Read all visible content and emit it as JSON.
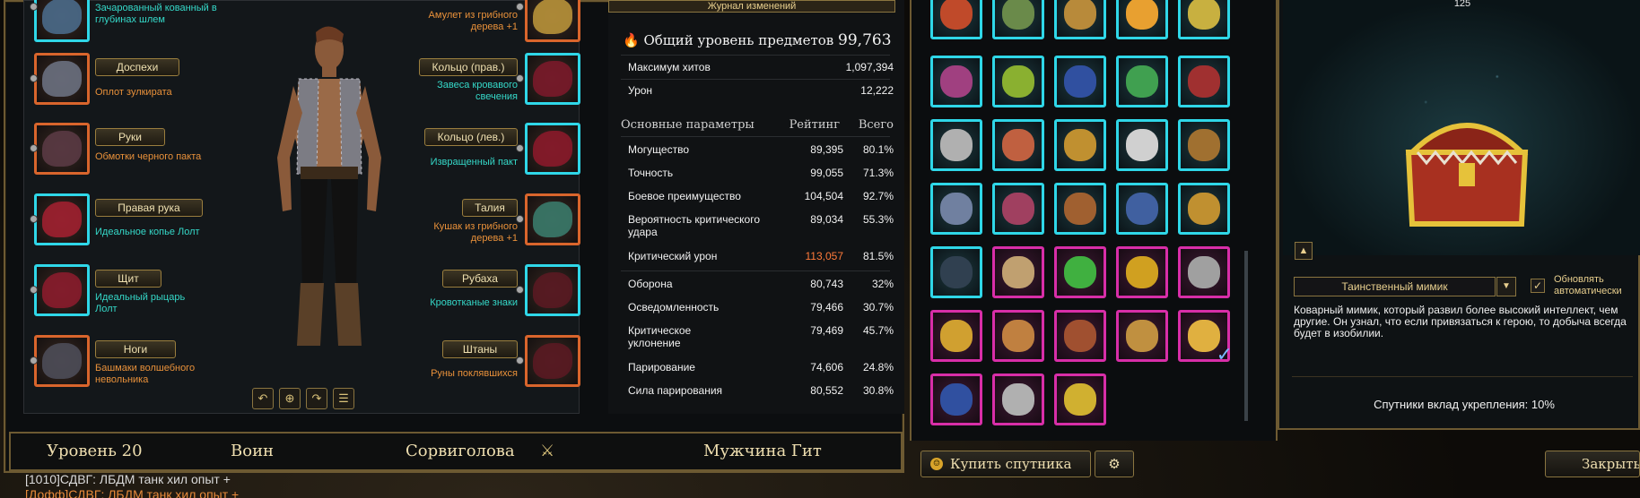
{
  "left_slots": [
    {
      "label": "",
      "name": "Зачарованный кованный в глубинах шлем",
      "color": "cyt"
    },
    {
      "label": "Доспехи",
      "name": "Оплот зулкирата",
      "color": "orf"
    },
    {
      "label": "Руки",
      "name": "Обмотки черного пакта",
      "color": "orf"
    },
    {
      "label": "Правая рука",
      "name": "Идеальное копье Лолт",
      "color": "cyt"
    },
    {
      "label": "Щит",
      "name": "Идеальный рыцарь Лолт",
      "color": "cyt"
    },
    {
      "label": "Ноги",
      "name": "Башмаки волшебного невольника",
      "color": "orf"
    }
  ],
  "right_slots": [
    {
      "label": "",
      "name": "Амулет из грибного дерева +1",
      "color": "orf"
    },
    {
      "label": "Кольцо (прав.)",
      "name": "Завеса кровавого свечения",
      "color": "cyt"
    },
    {
      "label": "Кольцо (лев.)",
      "name": "Извращенный пакт",
      "color": "cyt"
    },
    {
      "label": "Талия",
      "name": "Кушак из грибного дерева +1",
      "color": "orf"
    },
    {
      "label": "Рубаха",
      "name": "Кровотканые знаки",
      "color": "cyt"
    },
    {
      "label": "Штаны",
      "name": "Руны поклявшихся",
      "color": "orf"
    }
  ],
  "stats": {
    "journal": "Журнал изменений",
    "item_level_label": "Общий уровень предметов",
    "item_level": "99,763",
    "max_hp_label": "Максимум хитов",
    "max_hp": "1,097,394",
    "damage_label": "Урон",
    "damage": "12,222",
    "headers": {
      "main": "Основные параметры",
      "rating": "Рейтинг",
      "total": "Всего"
    },
    "rows": [
      {
        "name": "Могущество",
        "rating": "89,395",
        "pct": "80.1%"
      },
      {
        "name": "Точность",
        "rating": "99,055",
        "pct": "71.3%"
      },
      {
        "name": "Боевое преимущество",
        "rating": "104,504",
        "pct": "92.7%"
      },
      {
        "name": "Вероятность критического удара",
        "rating": "89,034",
        "pct": "55.3%"
      },
      {
        "name": "Критический урон",
        "rating": "113,057",
        "pct": "81.5%"
      },
      {
        "name": "Оборона",
        "rating": "80,743",
        "pct": "32%"
      },
      {
        "name": "Осведомленность",
        "rating": "79,466",
        "pct": "30.7%"
      },
      {
        "name": "Критическое уклонение",
        "rating": "79,469",
        "pct": "45.7%"
      },
      {
        "name": "Парирование",
        "rating": "74,606",
        "pct": "24.8%"
      },
      {
        "name": "Сила парирования",
        "rating": "80,552",
        "pct": "30.8%"
      }
    ]
  },
  "bottom": {
    "level": "Уровень 20",
    "class": "Воин",
    "paragon": "Сорвиголова",
    "race": "Мужчина Гит"
  },
  "chat": [
    "[1010]СДВГ: ЛБДМ танк хил опыт +",
    "[Дофф]СДВГ: ЛБДМ танк хил опыт +"
  ],
  "companion": {
    "top_number": "125",
    "name": "Таинственный мимик",
    "auto_update": "Обновлять автоматически",
    "description": "Коварный мимик, который развил более высокий интеллект, чем другие. Он узнал, что если привязаться к герою, то добыча всегда будет в изобилии.",
    "bonus": "Спутники вклад укрепления: 10%"
  },
  "buttons": {
    "buy": "Купить спутника",
    "close": "Закрыть"
  },
  "colors": {
    "frame_gold": "#6d5a32",
    "rare_cyan": "#2fd7e8",
    "mythic_magenta": "#d82ea8",
    "epic_orange": "#d9652c",
    "crit_value": "#ff7a3a"
  }
}
